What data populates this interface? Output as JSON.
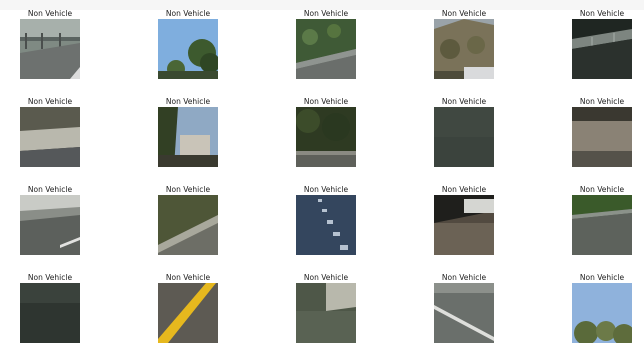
{
  "grid": {
    "rows": [
      [
        {
          "label": "Non Vehicle",
          "scene": "guardrail-road"
        },
        {
          "label": "Non Vehicle",
          "scene": "sky-tree"
        },
        {
          "label": "Non Vehicle",
          "scene": "hedge-road"
        },
        {
          "label": "Non Vehicle",
          "scene": "hill-trees"
        },
        {
          "label": "Non Vehicle",
          "scene": "dark-guardrail"
        }
      ],
      [
        {
          "label": "Non Vehicle",
          "scene": "barrier-road"
        },
        {
          "label": "Non Vehicle",
          "scene": "sign-sky"
        },
        {
          "label": "Non Vehicle",
          "scene": "trees-road"
        },
        {
          "label": "Non Vehicle",
          "scene": "plain-asphalt"
        },
        {
          "label": "Non Vehicle",
          "scene": "concrete-wall"
        }
      ],
      [
        {
          "label": "Non Vehicle",
          "scene": "road-marking"
        },
        {
          "label": "Non Vehicle",
          "scene": "grass-edge"
        },
        {
          "label": "Non Vehicle",
          "scene": "dashed-lane"
        },
        {
          "label": "Non Vehicle",
          "scene": "bridge-wall"
        },
        {
          "label": "Non Vehicle",
          "scene": "guardrail-curve"
        }
      ],
      [
        {
          "label": "Non Vehicle",
          "scene": "dark-asphalt"
        },
        {
          "label": "Non Vehicle",
          "scene": "yellow-line"
        },
        {
          "label": "Non Vehicle",
          "scene": "barrier-grass"
        },
        {
          "label": "Non Vehicle",
          "scene": "white-line"
        },
        {
          "label": "Non Vehicle",
          "scene": "sky-trees"
        }
      ]
    ]
  }
}
